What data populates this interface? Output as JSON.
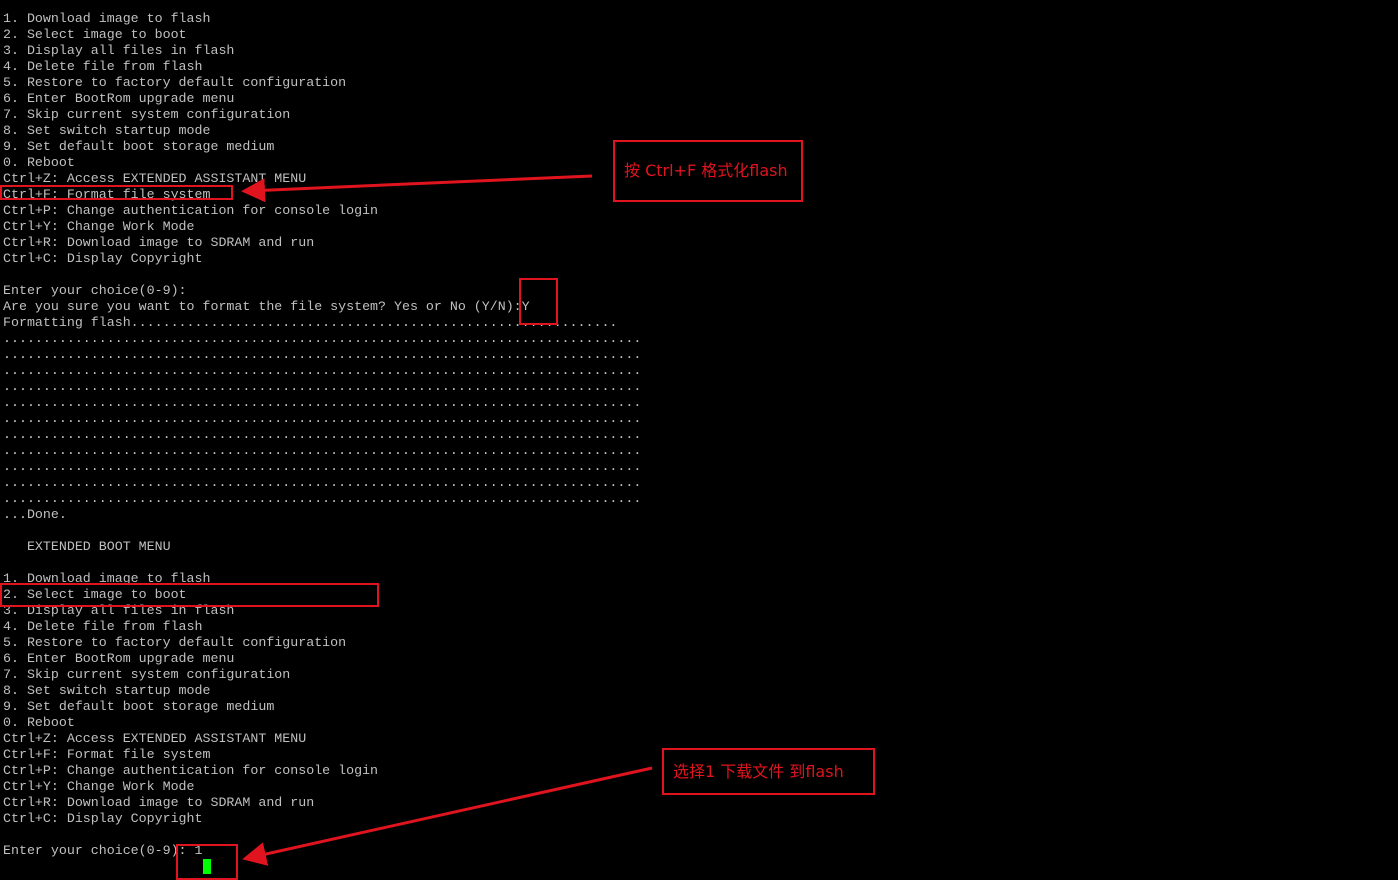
{
  "terminal": {
    "lines": [
      "1. Download image to flash",
      "2. Select image to boot",
      "3. Display all files in flash",
      "4. Delete file from flash",
      "5. Restore to factory default configuration",
      "6. Enter BootRom upgrade menu",
      "7. Skip current system configuration",
      "8. Set switch startup mode",
      "9. Set default boot storage medium",
      "0. Reboot",
      "Ctrl+Z: Access EXTENDED ASSISTANT MENU",
      "Ctrl+F: Format file system",
      "Ctrl+P: Change authentication for console login",
      "Ctrl+Y: Change Work Mode",
      "Ctrl+R: Download image to SDRAM and run",
      "Ctrl+C: Display Copyright",
      "",
      "Enter your choice(0-9):",
      "Are you sure you want to format the file system? Yes or No (Y/N):Y",
      "Formatting flash.............................................................",
      "................................................................................",
      "................................................................................",
      "................................................................................",
      "................................................................................",
      "................................................................................",
      "................................................................................",
      "................................................................................",
      "................................................................................",
      "................................................................................",
      "................................................................................",
      "................................................................................",
      "...Done.",
      "",
      "   EXTENDED BOOT MENU",
      "",
      "1. Download image to flash",
      "2. Select image to boot",
      "3. Display all files in flash",
      "4. Delete file from flash",
      "5. Restore to factory default configuration",
      "6. Enter BootRom upgrade menu",
      "7. Skip current system configuration",
      "8. Set switch startup mode",
      "9. Set default boot storage medium",
      "0. Reboot",
      "Ctrl+Z: Access EXTENDED ASSISTANT MENU",
      "Ctrl+F: Format file system",
      "Ctrl+P: Change authentication for console login",
      "Ctrl+Y: Change Work Mode",
      "Ctrl+R: Download image to SDRAM and run",
      "Ctrl+C: Display Copyright",
      "",
      "Enter your choice(0-9): 1"
    ]
  },
  "annotations": {
    "format_callout": "按 Ctrl+F 格式化flash",
    "download_callout": "选择1 下载文件 到flash"
  },
  "colors": {
    "background": "#000000",
    "terminal_text": "#c0c0c0",
    "cursor": "#00ff00",
    "annotation_red": "#e0141e"
  }
}
